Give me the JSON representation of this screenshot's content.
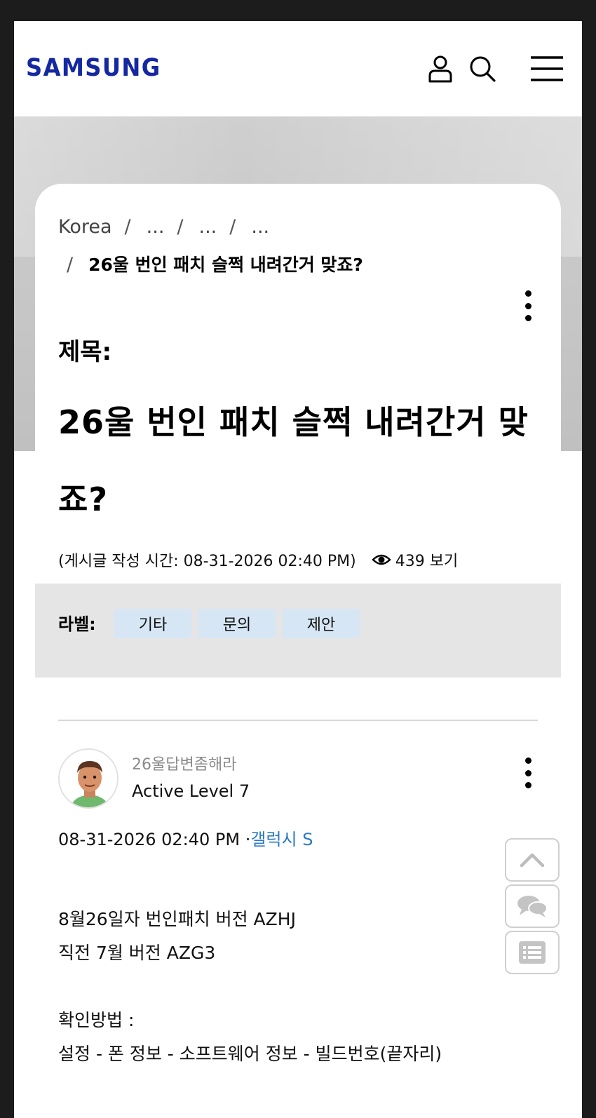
{
  "header": {
    "logo": "SAMSUNG",
    "icons": [
      "user-icon",
      "search-icon",
      "menu-icon"
    ],
    "brand_color": "#1428a0"
  },
  "breadcrumb": {
    "items": [
      "Korea",
      "...",
      "...",
      "..."
    ],
    "separator": "/",
    "current": "26울 번인 패치 슬쩍 내려간거 맞죠?"
  },
  "post": {
    "subject_label": "제목:",
    "title": "26울 번인 패치 슬쩍 내려간거 맞죠?",
    "meta": "(게시글 작성 시간: 08-31-2026 02:40 PM)",
    "views": "439 보기",
    "labels_title": "라벨:",
    "labels": [
      "기타",
      "문의",
      "제안"
    ],
    "author": "26울답변좀해라",
    "level": "Active Level 7",
    "date": "08-31-2026 02:40 PM ·",
    "category": "갤럭시 S",
    "body": [
      "8월26일자 번인패치 버전 AZHJ",
      "직전 7월 버전 AZG3",
      "",
      "확인방법 :",
      "설정 - 폰 정보 - 소프트웨어 정보 - 빌드번호(끝자리)"
    ]
  },
  "floating_buttons": [
    "scroll-top-icon",
    "chat-icon",
    "list-icon"
  ],
  "colors": {
    "label_chip": "#d6e6f5",
    "category_link": "#2b7bc4",
    "labels_bar": "#e5e5e5"
  }
}
